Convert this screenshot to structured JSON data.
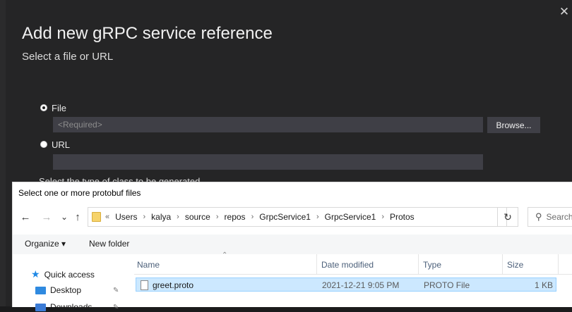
{
  "dialog": {
    "title": "Add new gRPC service reference",
    "subtitle": "Select a file or URL",
    "close_glyph": "✕",
    "file_option_label": "File",
    "file_placeholder": "<Required>",
    "browse_label": "Browse...",
    "url_option_label": "URL",
    "url_value": "",
    "cut_off_text": "Select the type of class to be generated"
  },
  "file_dialog": {
    "title": "Select one or more protobuf files",
    "nav": {
      "back": "←",
      "forward": "→",
      "recent": "⌄",
      "up": "↑"
    },
    "address": {
      "prefix": "«",
      "crumbs": [
        "Users",
        "kalya",
        "source",
        "repos",
        "GrpcService1",
        "GrpcService1",
        "Protos"
      ],
      "separator": "›"
    },
    "refresh_glyph": "↻",
    "search_placeholder": "Search",
    "search_glyph": "⚲",
    "toolbar": {
      "organize": "Organize ▾",
      "new_folder": "New folder"
    },
    "nav_pane": {
      "quick_access": "Quick access",
      "desktop": "Desktop",
      "downloads": "Downloads"
    },
    "columns": {
      "name": "Name",
      "date": "Date modified",
      "type": "Type",
      "size": "Size"
    },
    "files": [
      {
        "name": "greet.proto",
        "date": "2021-12-21 9:05 PM",
        "type": "PROTO File",
        "size": "1 KB",
        "selected": true
      }
    ]
  },
  "colors": {
    "dialog_bg": "#252526",
    "selection": "#cce8ff",
    "selection_border": "#99d1ff"
  },
  "icons": [
    "close-icon",
    "back-arrow-icon",
    "forward-arrow-icon",
    "chevron-down-icon",
    "up-arrow-icon",
    "folder-icon",
    "refresh-icon",
    "search-icon",
    "star-icon",
    "desktop-icon",
    "pin-icon",
    "file-icon"
  ]
}
